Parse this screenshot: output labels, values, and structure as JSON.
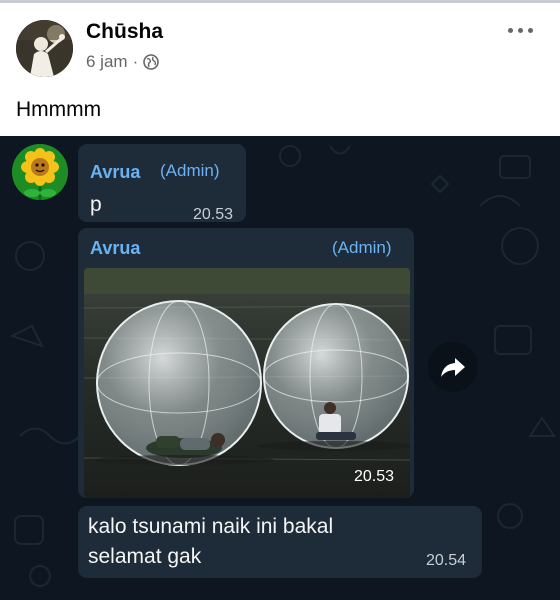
{
  "post": {
    "author": "Chūsha",
    "time": "6 jam",
    "separator": "·",
    "privacy_icon": "globe-icon",
    "more_icon": "more-dots-icon",
    "caption": "Hmmmm"
  },
  "chat": {
    "messages": [
      {
        "sender": "Avrua",
        "role": "(Admin)",
        "text": "p",
        "time": "20.53"
      },
      {
        "sender": "Avrua",
        "role": "(Admin)",
        "photo": "two people inside inflatable water balls on a lake",
        "time": "20.53"
      },
      {
        "text": "kalo tsunami naik ini bakal selamat gak",
        "time": "20.54"
      }
    ],
    "forward_icon": "forward-arrow-icon"
  },
  "colors": {
    "chat_background": "#0e1621",
    "bubble": "#1e2c3a",
    "sender_name": "#6ab2f2"
  }
}
